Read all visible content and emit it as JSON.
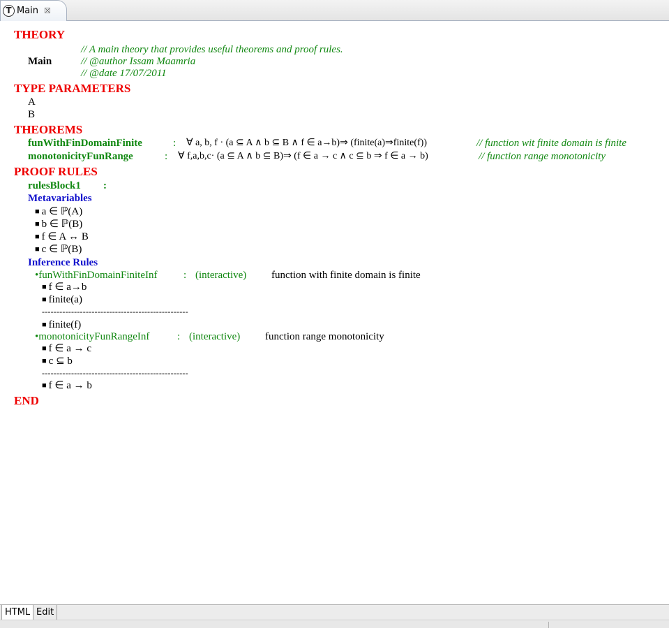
{
  "tab": {
    "icon": "T",
    "title": "Main",
    "close_glyph": "☒"
  },
  "theory": {
    "heading": "THEORY",
    "name": "Main",
    "comments": [
      "//  A main theory that provides useful theorems and proof rules.",
      "//  @author Issam Maamria",
      "//  @date 17/07/2011"
    ]
  },
  "type_parameters": {
    "heading": "TYPE PARAMETERS",
    "items": [
      "A",
      "B"
    ]
  },
  "theorems": {
    "heading": "THEOREMS",
    "items": [
      {
        "name": "funWithFinDomainFinite",
        "sep": ":",
        "formula": "∀ a, b, f · (a ⊆ A ∧ b ⊆ B ∧ f ∈ a→b)⇒ (finite(a)⇒finite(f))",
        "comment": "//  function wit finite domain is finite"
      },
      {
        "name": "monotonicityFunRange",
        "sep": ":",
        "formula": "∀ f,a,b,c· (a ⊆ A ∧ b ⊆ B)⇒ (f ∈ a → c ∧ c ⊆ b ⇒ f ∈ a → b)",
        "comment": "//  function range monotonicity"
      }
    ]
  },
  "proof_rules": {
    "heading": "PROOF RULES",
    "block_name": "rulesBlock1",
    "block_sep": ":",
    "metavariables_heading": "Metavariables",
    "metavariables": [
      "a ∈ ℙ(A)",
      "b ∈ ℙ(B)",
      "f ∈ A ↔ B",
      "c ∈ ℙ(B)"
    ],
    "inference_heading": "Inference Rules",
    "rules": [
      {
        "name": "•funWithFinDomainFiniteInf",
        "sep": ":",
        "mode": "(interactive)",
        "description": "function with finite domain is finite",
        "given": [
          "f ∈ a→b",
          "finite(a)"
        ],
        "line": "--------------------------------------------------",
        "infer": "finite(f)"
      },
      {
        "name": "•monotonicityFunRangeInf",
        "sep": ":",
        "mode": "(interactive)",
        "description": "function range monotonicity",
        "given": [
          "f ∈ a → c",
          "c ⊆ b"
        ],
        "line": "--------------------------------------------------",
        "infer": "f ∈ a → b"
      }
    ]
  },
  "end": "END",
  "bullet": "■",
  "page_tabs": [
    {
      "label": "HTML",
      "active": true
    },
    {
      "label": "Edit",
      "active": false
    }
  ]
}
